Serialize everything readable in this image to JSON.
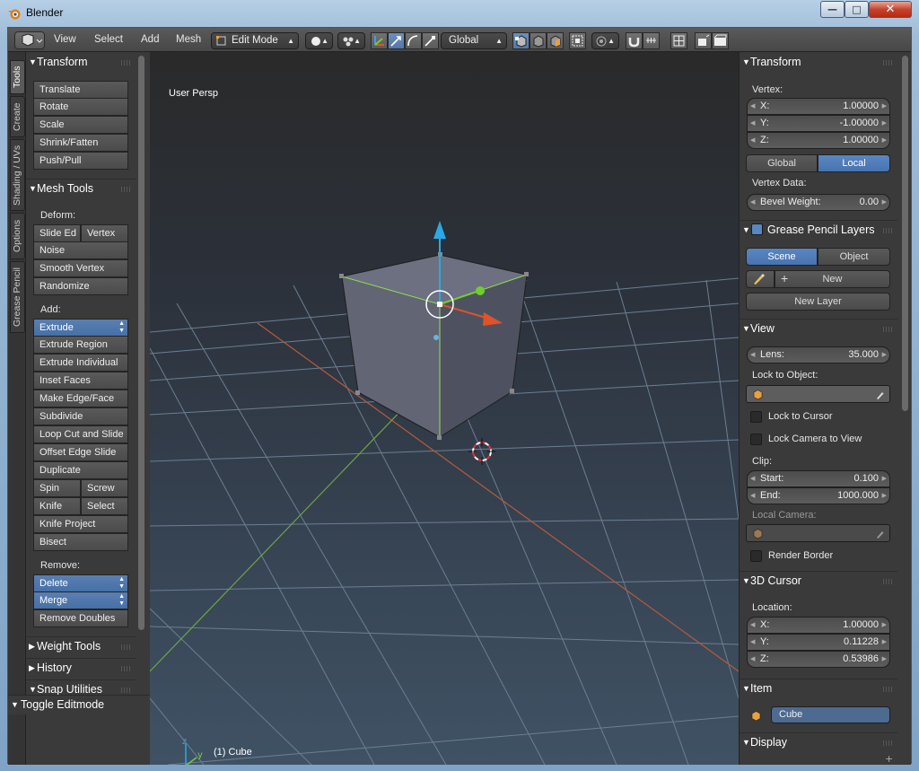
{
  "window": {
    "title": "Blender",
    "minimize": "—",
    "maximize": "□",
    "close": "✕"
  },
  "header": {
    "menus": [
      "View",
      "Select",
      "Add",
      "Mesh"
    ],
    "mode": "Edit Mode",
    "orientation": "Global"
  },
  "tabs": [
    "Tools",
    "Create",
    "Shading / UVs",
    "Options",
    "Grease Pencil"
  ],
  "toolshelf": {
    "transform": {
      "title": "Transform",
      "buttons": [
        "Translate",
        "Rotate",
        "Scale",
        "Shrink/Fatten",
        "Push/Pull"
      ]
    },
    "mesh_tools": {
      "title": "Mesh Tools",
      "deform_label": "Deform:",
      "slide_edge": "Slide Ed",
      "vertex": "Vertex",
      "noise": "Noise",
      "smooth_vertex": "Smooth Vertex",
      "randomize": "Randomize",
      "add_label": "Add:",
      "extrude": "Extrude",
      "extrude_region": "Extrude Region",
      "extrude_individual": "Extrude Individual",
      "inset_faces": "Inset Faces",
      "make_edge_face": "Make Edge/Face",
      "subdivide": "Subdivide",
      "loop_cut": "Loop Cut and Slide",
      "offset_edge": "Offset Edge Slide",
      "duplicate": "Duplicate",
      "spin": "Spin",
      "screw": "Screw",
      "knife": "Knife",
      "select": "Select",
      "knife_project": "Knife Project",
      "bisect": "Bisect",
      "remove_label": "Remove:",
      "delete": "Delete",
      "merge": "Merge",
      "remove_doubles": "Remove Doubles"
    },
    "weight_tools": "Weight Tools",
    "history": "History",
    "snap_utilities": "Snap Utilities",
    "toggle_editmode": "Toggle Editmode"
  },
  "viewport": {
    "view_name": "User Persp",
    "object_label": "(1) Cube"
  },
  "npanel": {
    "transform": {
      "title": "Transform",
      "vertex_label": "Vertex:",
      "x_label": "X:",
      "x": "1.00000",
      "y_label": "Y:",
      "y": "-1.00000",
      "z_label": "Z:",
      "z": "1.00000",
      "global": "Global",
      "local": "Local",
      "vertex_data_label": "Vertex Data:",
      "bevel_label": "Bevel Weight:",
      "bevel": "0.00"
    },
    "grease": {
      "title": "Grease Pencil Layers",
      "scene": "Scene",
      "object": "Object",
      "new": "New",
      "new_layer": "New Layer"
    },
    "view": {
      "title": "View",
      "lens_label": "Lens:",
      "lens": "35.000",
      "lock_label": "Lock to Object:",
      "lock_cursor": "Lock to Cursor",
      "lock_camera": "Lock Camera to View",
      "clip_label": "Clip:",
      "start_label": "Start:",
      "start": "0.100",
      "end_label": "End:",
      "end": "1000.000",
      "local_camera": "Local Camera:",
      "render_border": "Render Border"
    },
    "cursor": {
      "title": "3D Cursor",
      "location_label": "Location:",
      "x_label": "X:",
      "x": "1.00000",
      "y_label": "Y:",
      "y": "0.11228",
      "z_label": "Z:",
      "z": "0.53986"
    },
    "item": {
      "title": "Item",
      "name": "Cube"
    },
    "display": {
      "title": "Display"
    }
  },
  "colors": {
    "accent": "#5a86c2",
    "x_axis": "#e0522a",
    "y_axis": "#7ac93a",
    "z_axis": "#2aa8e8"
  }
}
